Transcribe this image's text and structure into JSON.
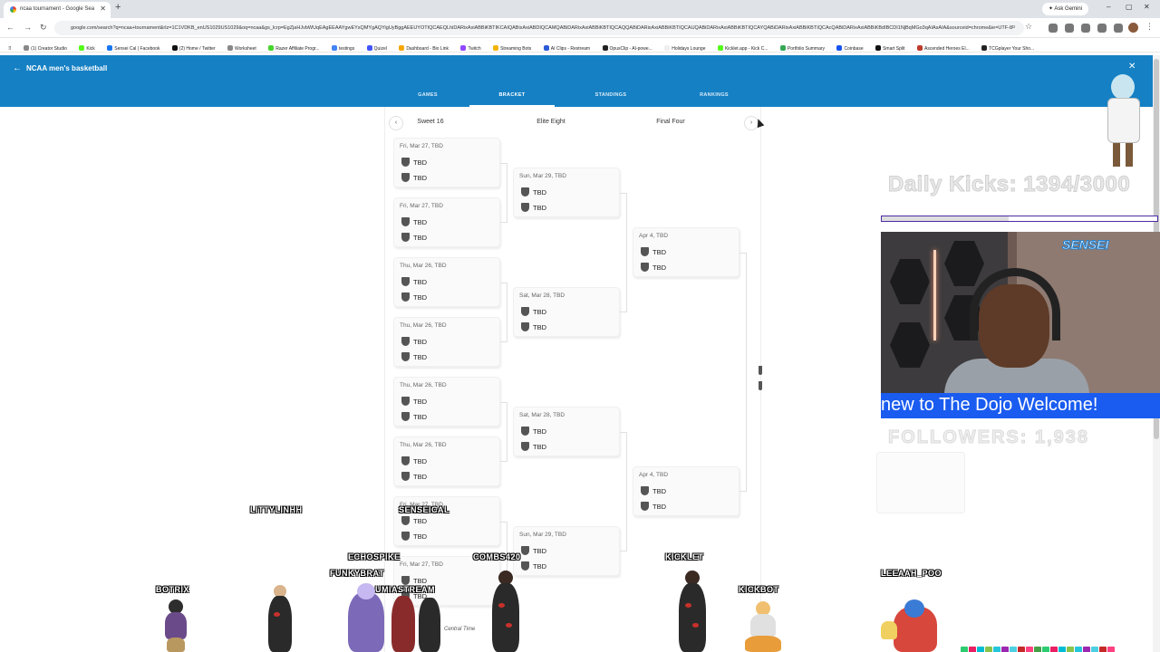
{
  "browser": {
    "tab_title": "ncaa tournament - Google Sea",
    "new_tab": "+",
    "ask_gemini": "Ask Gemini",
    "url": "google.com/search?q=ncaa+tournament&rlz=1C1VDKB_enUS1029US1029&oq=ncaa&gs_lcrp=EgZjaHJvbWUqEAgEEAAYgwEYsQMYgAQYigUyBggAEEUYOTIQCAEQLhiDARixAxiABBiKBTIKCAIQABixAxiABDIQCAMQABiDARixAxiABBiKBTIQCAQQABiDARixAxiABBiKBTIQCAUQABiDARixAxiABBiKBTIQCAYQABiDARixAxiABBiKBTIQCAcQABiDARixAxiABBiKBdIBCDI1NjBqMGo3qAIAsAIA&sourceid=chrome&ie=UTF-8",
    "window_controls": [
      "–",
      "▢",
      "✕"
    ],
    "bookmarks": [
      "(1) Creator Studio",
      "Kick",
      "Sensei Cal | Facebook",
      "(2) Home / Twitter",
      "Worksheet",
      "Razer Affiliate Progr...",
      "testings",
      "Quizel",
      "Dashboard - Bio Link",
      "Twitch",
      "Streaming Bots",
      "AI Clips - Restream",
      "OpusClip - AI-powe...",
      "Holidays Lounge",
      "Kicklet.app - Kick C...",
      "Portfolio Summary",
      "Coinbase",
      "Smart Split",
      "Ascended Heroes El...",
      "TCGplayer Your Sho..."
    ]
  },
  "sports": {
    "title": "NCAA men's basketball",
    "tabs": [
      {
        "label": "GAMES",
        "active": false
      },
      {
        "label": "BRACKET",
        "active": true
      },
      {
        "label": "STANDINGS",
        "active": false
      },
      {
        "label": "RANKINGS",
        "active": false
      }
    ]
  },
  "bracket": {
    "rounds": [
      "Sweet 16",
      "Elite Eight",
      "Final Four"
    ],
    "sweet16": [
      {
        "date": "Fri, Mar 27, TBD",
        "team1": "TBD",
        "team2": "TBD"
      },
      {
        "date": "Fri, Mar 27, TBD",
        "team1": "TBD",
        "team2": "TBD"
      },
      {
        "date": "Thu, Mar 26, TBD",
        "team1": "TBD",
        "team2": "TBD"
      },
      {
        "date": "Thu, Mar 26, TBD",
        "team1": "TBD",
        "team2": "TBD"
      },
      {
        "date": "Thu, Mar 26, TBD",
        "team1": "TBD",
        "team2": "TBD"
      },
      {
        "date": "Thu, Mar 26, TBD",
        "team1": "TBD",
        "team2": "TBD"
      },
      {
        "date": "Fri, Mar 27, TBD",
        "team1": "TBD",
        "team2": "TBD"
      },
      {
        "date": "Fri, Mar 27, TBD",
        "team1": "TBD",
        "team2": "TBD"
      }
    ],
    "elite8": [
      {
        "date": "Sun, Mar 29, TBD",
        "team1": "TBD",
        "team2": "TBD"
      },
      {
        "date": "Sat, Mar 28, TBD",
        "team1": "TBD",
        "team2": "TBD"
      },
      {
        "date": "Sat, Mar 28, TBD",
        "team1": "TBD",
        "team2": "TBD"
      },
      {
        "date": "Sun, Mar 29, TBD",
        "team1": "TBD",
        "team2": "TBD"
      }
    ],
    "final4": [
      {
        "date": "Apr 4, TBD",
        "team1": "TBD",
        "team2": "TBD"
      },
      {
        "date": "Apr 4, TBD",
        "team1": "TBD",
        "team2": "TBD"
      }
    ],
    "footer_note": "Central Time"
  },
  "stream_overlay": {
    "daily_kicks": "Daily Kicks: 1394/3000",
    "daily_kicks_progress": 0.46,
    "webcam_logo": "SENSEI",
    "chat_banner": "new to The Dojo Welcome!",
    "followers": "FOLLOWERS: 1,938",
    "chatters": [
      "LITTYLINHH",
      "SENSEICAL",
      "ECHOSPIKE",
      "COMBS420",
      "KICKLET",
      "FUNKYBRAT",
      "LUMIASTREAM",
      "BOTRIX",
      "KICKBOT",
      "LEEAAH_POO"
    ],
    "badges": [
      "100",
      "50",
      "10",
      "100",
      "20",
      "10",
      "5",
      "10",
      "5",
      "10",
      "5",
      "10",
      "1",
      "20",
      "10",
      "50",
      "5",
      "10",
      "100"
    ],
    "colors": {
      "chat_banner": "#1a5cf0",
      "progress_frame": "#4b2ba3",
      "sports_header": "#1580c4"
    }
  }
}
